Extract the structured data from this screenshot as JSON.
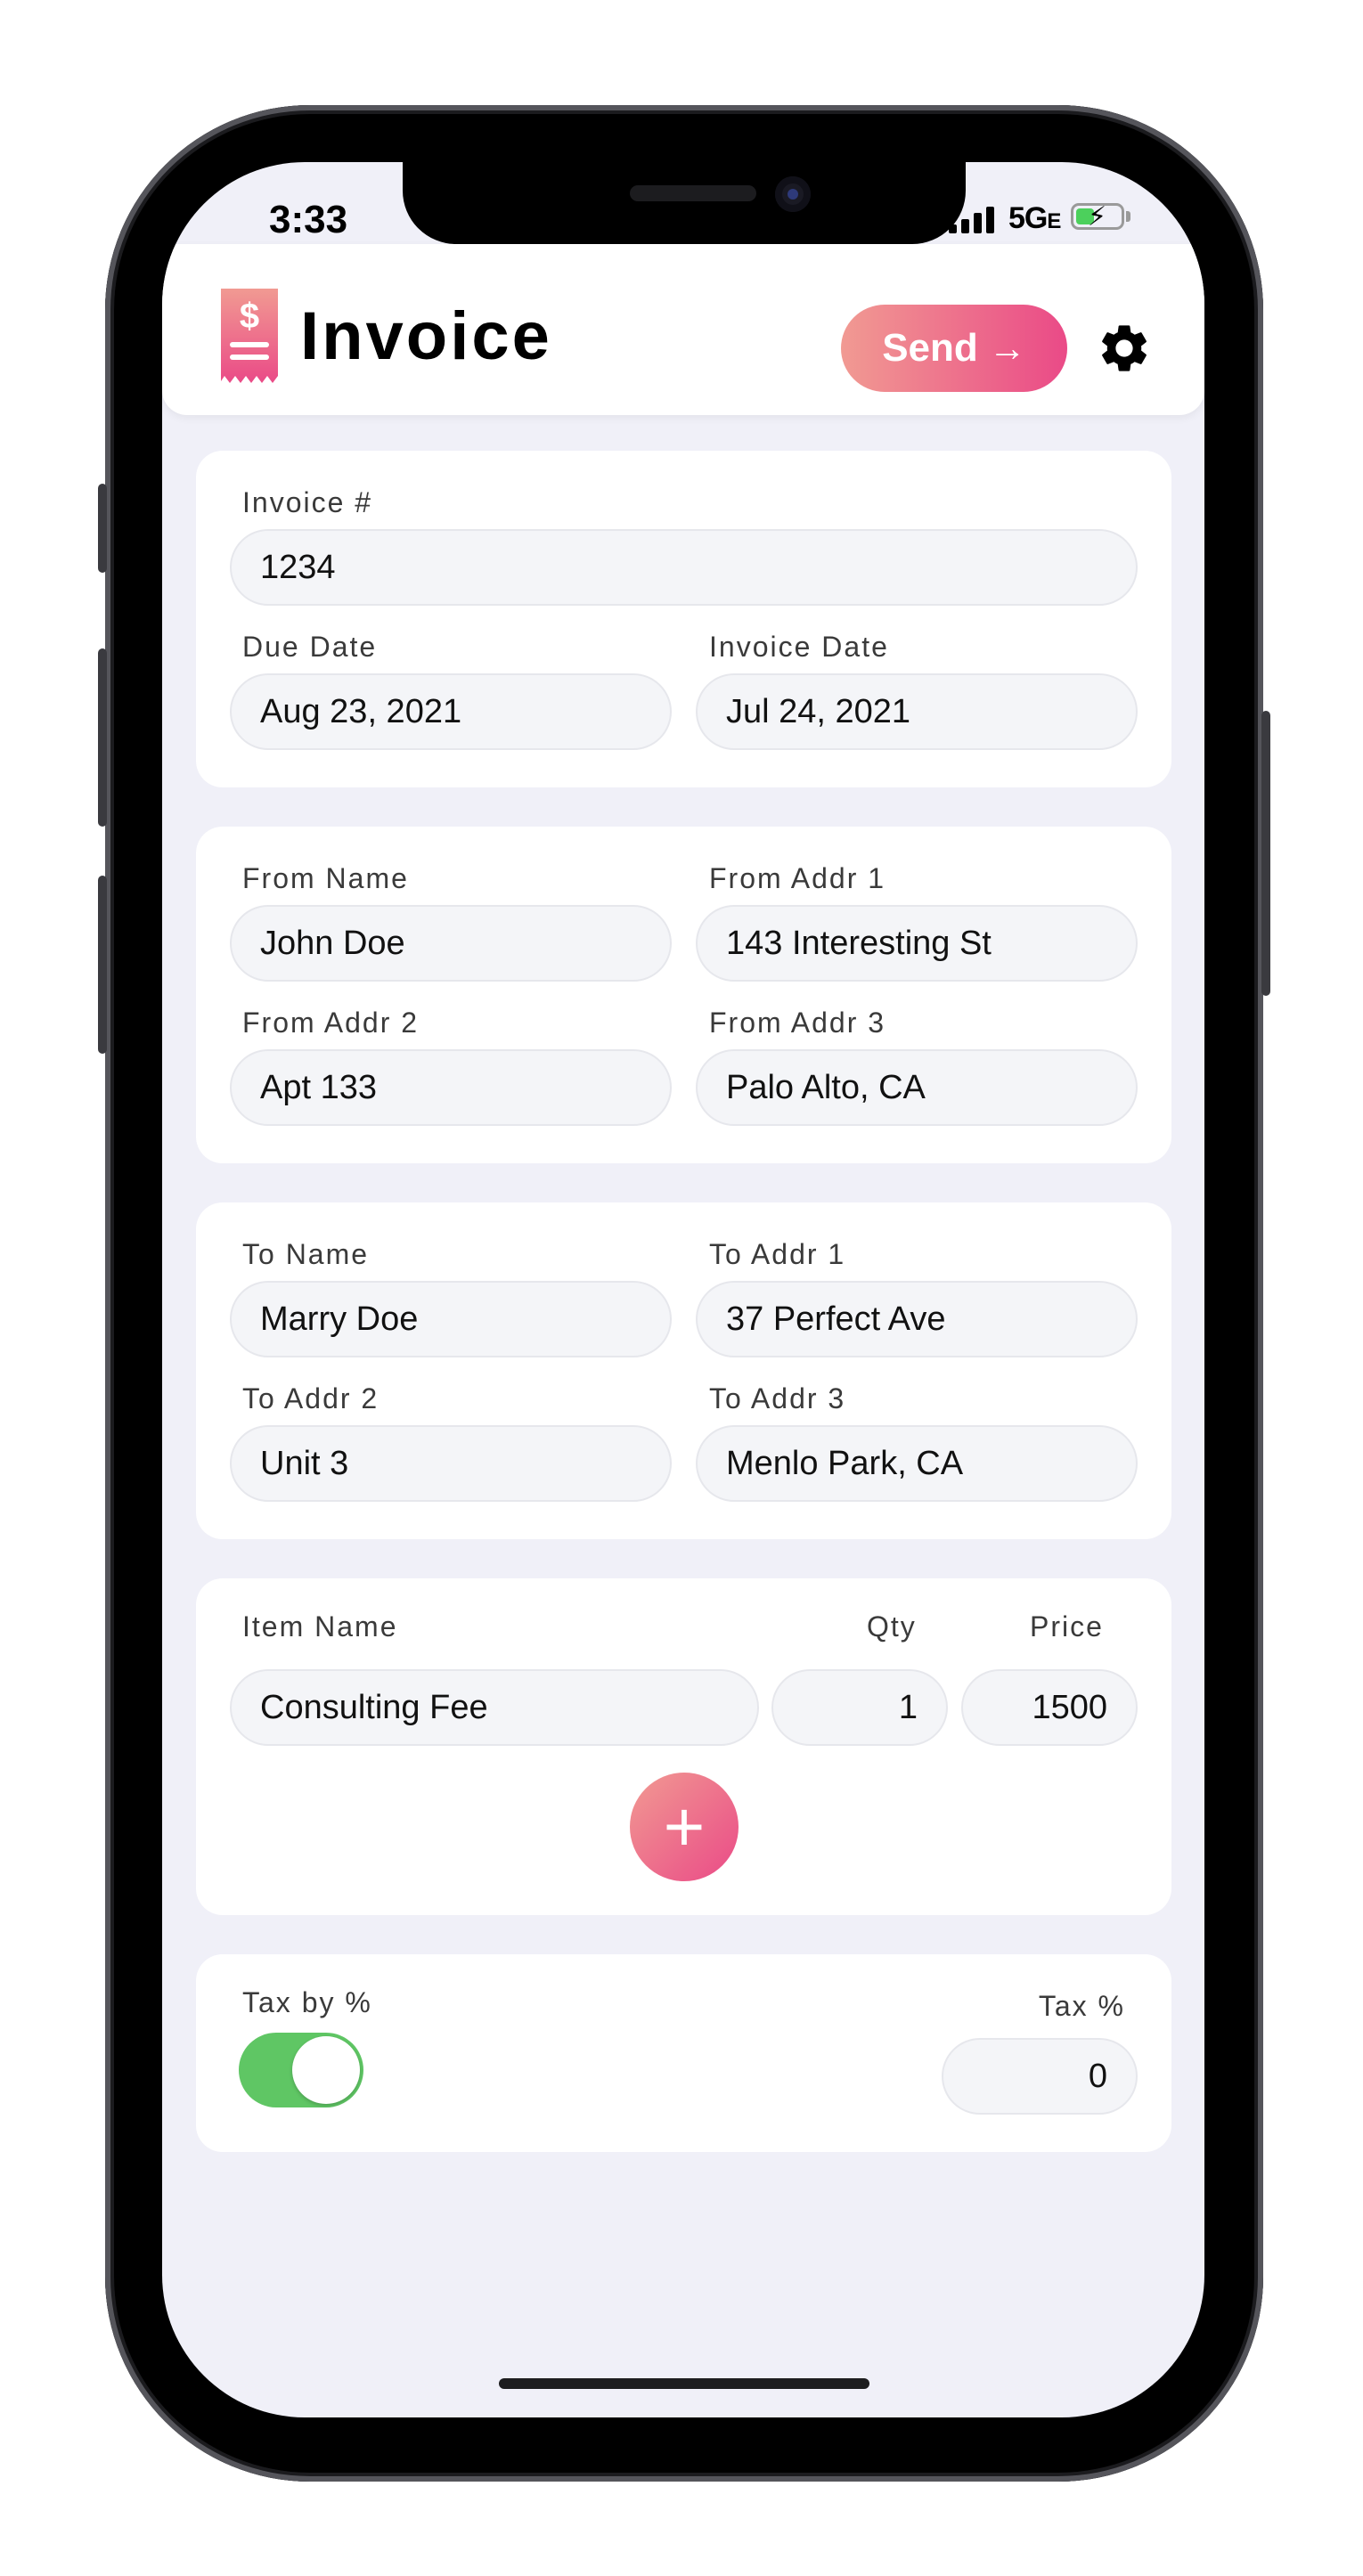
{
  "status": {
    "time": "3:33",
    "network": "5G",
    "network_suffix": "E"
  },
  "header": {
    "title": "Invoice",
    "send_label": "Send",
    "send_icon": "arrow-right-icon",
    "settings_icon": "gear-icon"
  },
  "invoice": {
    "number_label": "Invoice #",
    "number": "1234",
    "due_label": "Due Date",
    "due": "Aug 23, 2021",
    "date_label": "Invoice Date",
    "date": "Jul 24, 2021"
  },
  "from": {
    "name_label": "From Name",
    "name": "John Doe",
    "addr1_label": "From Addr 1",
    "addr1": "143 Interesting St",
    "addr2_label": "From Addr 2",
    "addr2": "Apt 133",
    "addr3_label": "From Addr 3",
    "addr3": "Palo Alto, CA"
  },
  "to": {
    "name_label": "To Name",
    "name": "Marry Doe",
    "addr1_label": "To Addr 1",
    "addr1": "37 Perfect Ave",
    "addr2_label": "To Addr 2",
    "addr2": "Unit 3",
    "addr3_label": "To Addr 3",
    "addr3": "Menlo Park, CA"
  },
  "items": {
    "name_header": "Item Name",
    "qty_header": "Qty",
    "price_header": "Price",
    "rows": [
      {
        "name": "Consulting Fee",
        "qty": "1",
        "price": "1500"
      }
    ],
    "add_label": "+"
  },
  "tax": {
    "by_percent_label": "Tax by %",
    "by_percent_enabled": true,
    "percent_label": "Tax %",
    "percent": "0"
  },
  "colors": {
    "accent_start": "#f19a92",
    "accent_end": "#ea4a87",
    "toggle_on": "#5fc664",
    "background": "#f0f0f8"
  }
}
